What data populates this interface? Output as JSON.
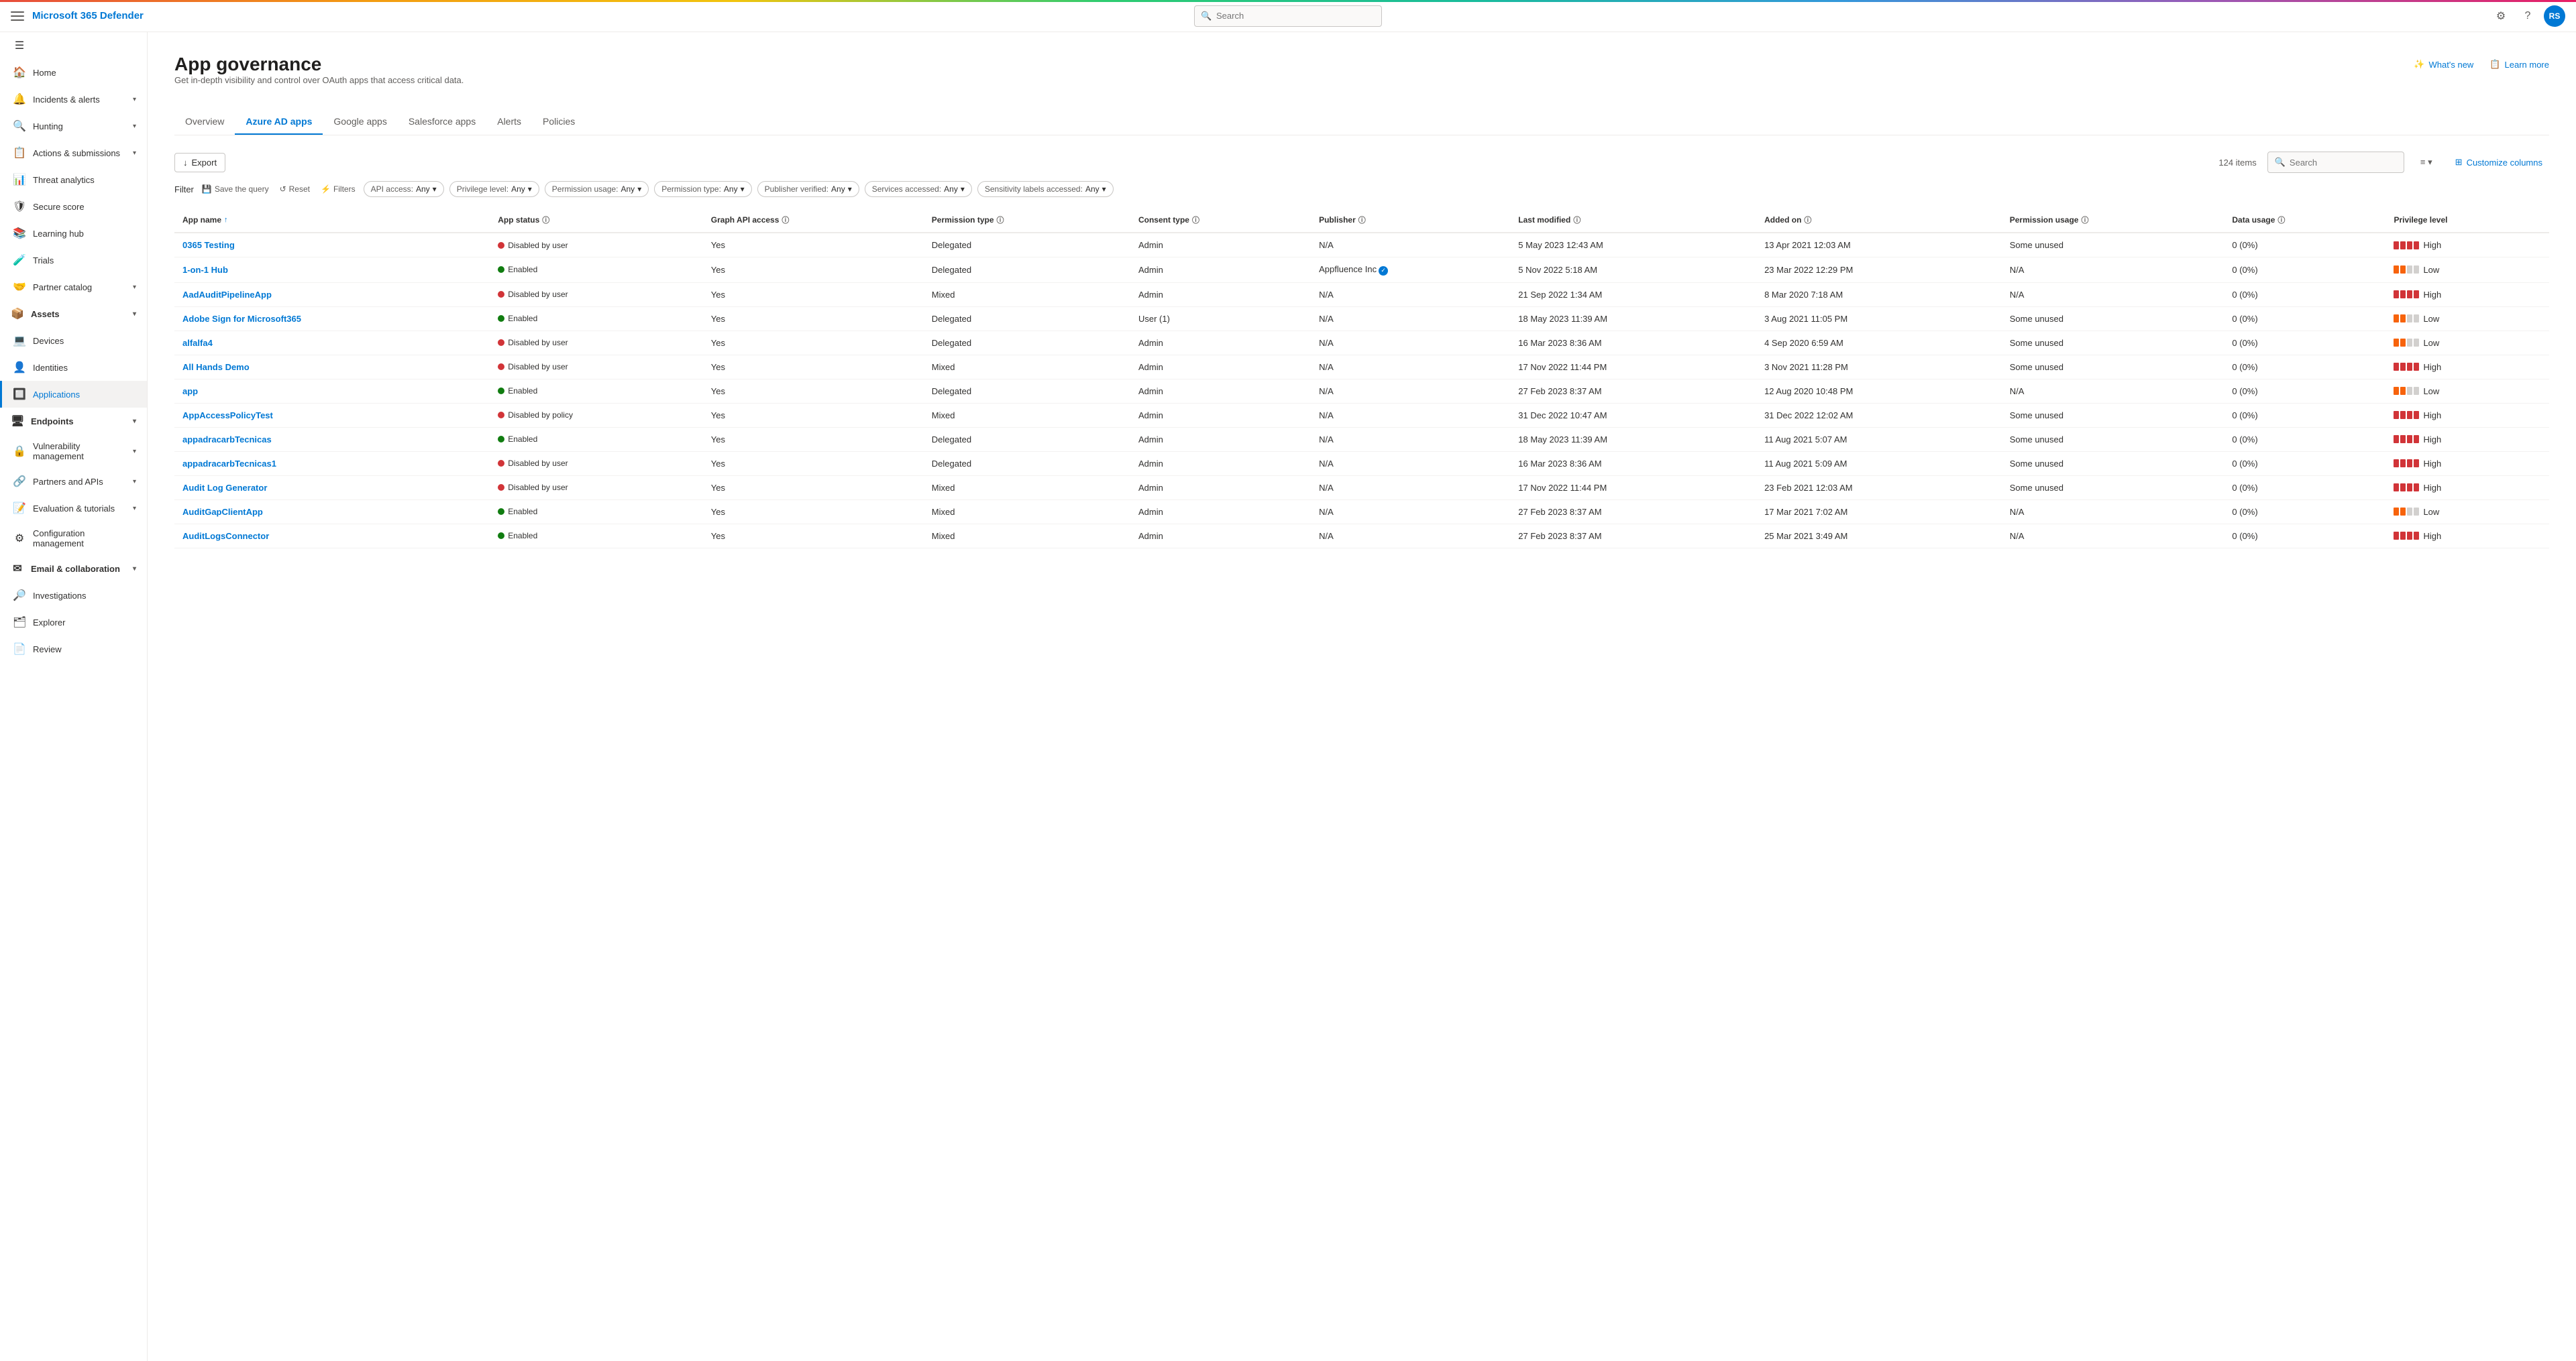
{
  "topbar": {
    "brand": "Microsoft 365 Defender",
    "search_placeholder": "Search",
    "avatar_initials": "RS"
  },
  "sidebar": {
    "collapse_label": "Collapse",
    "items": [
      {
        "id": "home",
        "icon": "🏠",
        "label": "Home",
        "chevron": false,
        "active": false
      },
      {
        "id": "incidents",
        "icon": "🔔",
        "label": "Incidents & alerts",
        "chevron": true,
        "active": false
      },
      {
        "id": "hunting",
        "icon": "🔍",
        "label": "Hunting",
        "chevron": true,
        "active": false
      },
      {
        "id": "actions",
        "icon": "📋",
        "label": "Actions & submissions",
        "chevron": true,
        "active": false
      },
      {
        "id": "threat",
        "icon": "📊",
        "label": "Threat analytics",
        "chevron": false,
        "active": false
      },
      {
        "id": "secure",
        "icon": "🛡",
        "label": "Secure score",
        "chevron": false,
        "active": false
      },
      {
        "id": "learning",
        "icon": "📚",
        "label": "Learning hub",
        "chevron": false,
        "active": false
      },
      {
        "id": "trials",
        "icon": "🧪",
        "label": "Trials",
        "chevron": false,
        "active": false
      },
      {
        "id": "partner",
        "icon": "🤝",
        "label": "Partner catalog",
        "chevron": true,
        "active": false
      },
      {
        "id": "assets-header",
        "icon": "📦",
        "label": "Assets",
        "section": true,
        "chevron": true
      },
      {
        "id": "devices",
        "icon": "💻",
        "label": "Devices",
        "chevron": false,
        "active": false
      },
      {
        "id": "identities",
        "icon": "👤",
        "label": "Identities",
        "chevron": false,
        "active": false
      },
      {
        "id": "applications",
        "icon": "🔲",
        "label": "Applications",
        "chevron": false,
        "active": true
      },
      {
        "id": "endpoints-header",
        "icon": "🖥",
        "label": "Endpoints",
        "section": true,
        "chevron": true
      },
      {
        "id": "vulnerability",
        "icon": "🔒",
        "label": "Vulnerability management",
        "chevron": true,
        "active": false
      },
      {
        "id": "partners-apis",
        "icon": "🔗",
        "label": "Partners and APIs",
        "chevron": true,
        "active": false
      },
      {
        "id": "evaluation",
        "icon": "📝",
        "label": "Evaluation & tutorials",
        "chevron": true,
        "active": false
      },
      {
        "id": "config-mgmt",
        "icon": "⚙",
        "label": "Configuration management",
        "chevron": false,
        "active": false
      },
      {
        "id": "email-collab",
        "icon": "✉",
        "label": "Email & collaboration",
        "section": true,
        "chevron": true
      },
      {
        "id": "investigations",
        "icon": "🔎",
        "label": "Investigations",
        "chevron": false,
        "active": false
      },
      {
        "id": "explorer",
        "icon": "🗂",
        "label": "Explorer",
        "chevron": false,
        "active": false
      },
      {
        "id": "review",
        "icon": "📄",
        "label": "Review",
        "chevron": false,
        "active": false
      }
    ]
  },
  "page": {
    "title": "App governance",
    "subtitle": "Get in-depth visibility and control over OAuth apps that access critical data.",
    "whats_new_label": "What's new",
    "learn_more_label": "Learn more"
  },
  "tabs": [
    {
      "id": "overview",
      "label": "Overview"
    },
    {
      "id": "azure-ad-apps",
      "label": "Azure AD apps",
      "active": true
    },
    {
      "id": "google-apps",
      "label": "Google apps"
    },
    {
      "id": "salesforce-apps",
      "label": "Salesforce apps"
    },
    {
      "id": "alerts",
      "label": "Alerts"
    },
    {
      "id": "policies",
      "label": "Policies"
    }
  ],
  "toolbar": {
    "export_label": "Export",
    "item_count": "124 items",
    "search_placeholder": "Search",
    "customize_columns_label": "Customize columns"
  },
  "filter_bar": {
    "label": "Filter",
    "save_query_label": "Save the query",
    "reset_label": "Reset",
    "filters_label": "Filters",
    "dropdowns": [
      {
        "key": "API access:",
        "value": "Any"
      },
      {
        "key": "Privilege level:",
        "value": "Any"
      },
      {
        "key": "Permission usage:",
        "value": "Any"
      },
      {
        "key": "Permission type:",
        "value": "Any"
      },
      {
        "key": "Publisher verified:",
        "value": "Any"
      },
      {
        "key": "Services accessed:",
        "value": "Any"
      },
      {
        "key": "Sensitivity labels accessed:",
        "value": "Any"
      }
    ]
  },
  "table": {
    "columns": [
      {
        "id": "app-name",
        "label": "App name",
        "sortable": true,
        "info": false
      },
      {
        "id": "app-status",
        "label": "App status",
        "sortable": false,
        "info": true
      },
      {
        "id": "graph-api-access",
        "label": "Graph API access",
        "sortable": false,
        "info": true
      },
      {
        "id": "permission-type",
        "label": "Permission type",
        "sortable": false,
        "info": true
      },
      {
        "id": "consent-type",
        "label": "Consent type",
        "sortable": false,
        "info": true
      },
      {
        "id": "publisher",
        "label": "Publisher",
        "sortable": false,
        "info": true
      },
      {
        "id": "last-modified",
        "label": "Last modified",
        "sortable": false,
        "info": true
      },
      {
        "id": "added-on",
        "label": "Added on",
        "sortable": false,
        "info": true
      },
      {
        "id": "permission-usage",
        "label": "Permission usage",
        "sortable": false,
        "info": true
      },
      {
        "id": "data-usage",
        "label": "Data usage",
        "sortable": false,
        "info": true
      },
      {
        "id": "privilege-level",
        "label": "Privilege level",
        "sortable": false,
        "info": false
      }
    ],
    "rows": [
      {
        "name": "0365 Testing",
        "status": "Disabled by user",
        "status_type": "disabled",
        "graph_api": "Yes",
        "perm_type": "Delegated",
        "consent": "Admin",
        "publisher": "N/A",
        "publisher_verified": false,
        "last_modified": "5 May 2023 12:43 AM",
        "added_on": "13 Apr 2021 12:03 AM",
        "perm_usage": "Some unused",
        "data_usage": "0 (0%)",
        "privilege": "High",
        "privilege_level": "high"
      },
      {
        "name": "1-on-1 Hub",
        "status": "Enabled",
        "status_type": "enabled",
        "graph_api": "Yes",
        "perm_type": "Delegated",
        "consent": "Admin",
        "publisher": "Appfluence Inc",
        "publisher_verified": true,
        "last_modified": "5 Nov 2022 5:18 AM",
        "added_on": "23 Mar 2022 12:29 PM",
        "perm_usage": "N/A",
        "data_usage": "0 (0%)",
        "privilege": "Low",
        "privilege_level": "low"
      },
      {
        "name": "AadAuditPipelineApp",
        "status": "Disabled by user",
        "status_type": "disabled",
        "graph_api": "Yes",
        "perm_type": "Mixed",
        "consent": "Admin",
        "publisher": "N/A",
        "publisher_verified": false,
        "last_modified": "21 Sep 2022 1:34 AM",
        "added_on": "8 Mar 2020 7:18 AM",
        "perm_usage": "N/A",
        "data_usage": "0 (0%)",
        "privilege": "High",
        "privilege_level": "high"
      },
      {
        "name": "Adobe Sign for Microsoft365",
        "status": "Enabled",
        "status_type": "enabled",
        "graph_api": "Yes",
        "perm_type": "Delegated",
        "consent": "User (1)",
        "publisher": "N/A",
        "publisher_verified": false,
        "last_modified": "18 May 2023 11:39 AM",
        "added_on": "3 Aug 2021 11:05 PM",
        "perm_usage": "Some unused",
        "data_usage": "0 (0%)",
        "privilege": "Low",
        "privilege_level": "low"
      },
      {
        "name": "alfalfa4",
        "status": "Disabled by user",
        "status_type": "disabled",
        "graph_api": "Yes",
        "perm_type": "Delegated",
        "consent": "Admin",
        "publisher": "N/A",
        "publisher_verified": false,
        "last_modified": "16 Mar 2023 8:36 AM",
        "added_on": "4 Sep 2020 6:59 AM",
        "perm_usage": "Some unused",
        "data_usage": "0 (0%)",
        "privilege": "Low",
        "privilege_level": "low"
      },
      {
        "name": "All Hands Demo",
        "status": "Disabled by user",
        "status_type": "disabled",
        "graph_api": "Yes",
        "perm_type": "Mixed",
        "consent": "Admin",
        "publisher": "N/A",
        "publisher_verified": false,
        "last_modified": "17 Nov 2022 11:44 PM",
        "added_on": "3 Nov 2021 11:28 PM",
        "perm_usage": "Some unused",
        "data_usage": "0 (0%)",
        "privilege": "High",
        "privilege_level": "high"
      },
      {
        "name": "app",
        "status": "Enabled",
        "status_type": "enabled",
        "graph_api": "Yes",
        "perm_type": "Delegated",
        "consent": "Admin",
        "publisher": "N/A",
        "publisher_verified": false,
        "last_modified": "27 Feb 2023 8:37 AM",
        "added_on": "12 Aug 2020 10:48 PM",
        "perm_usage": "N/A",
        "data_usage": "0 (0%)",
        "privilege": "Low",
        "privilege_level": "low"
      },
      {
        "name": "AppAccessPolicyTest",
        "status": "Disabled by policy",
        "status_type": "disabled",
        "graph_api": "Yes",
        "perm_type": "Mixed",
        "consent": "Admin",
        "publisher": "N/A",
        "publisher_verified": false,
        "last_modified": "31 Dec 2022 10:47 AM",
        "added_on": "31 Dec 2022 12:02 AM",
        "perm_usage": "Some unused",
        "data_usage": "0 (0%)",
        "privilege": "High",
        "privilege_level": "high"
      },
      {
        "name": "appadracarbTecnicas",
        "status": "Enabled",
        "status_type": "enabled",
        "graph_api": "Yes",
        "perm_type": "Delegated",
        "consent": "Admin",
        "publisher": "N/A",
        "publisher_verified": false,
        "last_modified": "18 May 2023 11:39 AM",
        "added_on": "11 Aug 2021 5:07 AM",
        "perm_usage": "Some unused",
        "data_usage": "0 (0%)",
        "privilege": "High",
        "privilege_level": "high"
      },
      {
        "name": "appadracarbTecnicas1",
        "status": "Disabled by user",
        "status_type": "disabled",
        "graph_api": "Yes",
        "perm_type": "Delegated",
        "consent": "Admin",
        "publisher": "N/A",
        "publisher_verified": false,
        "last_modified": "16 Mar 2023 8:36 AM",
        "added_on": "11 Aug 2021 5:09 AM",
        "perm_usage": "Some unused",
        "data_usage": "0 (0%)",
        "privilege": "High",
        "privilege_level": "high"
      },
      {
        "name": "Audit Log Generator",
        "status": "Disabled by user",
        "status_type": "disabled",
        "graph_api": "Yes",
        "perm_type": "Mixed",
        "consent": "Admin",
        "publisher": "N/A",
        "publisher_verified": false,
        "last_modified": "17 Nov 2022 11:44 PM",
        "added_on": "23 Feb 2021 12:03 AM",
        "perm_usage": "Some unused",
        "data_usage": "0 (0%)",
        "privilege": "High",
        "privilege_level": "high"
      },
      {
        "name": "AuditGapClientApp",
        "status": "Enabled",
        "status_type": "enabled",
        "graph_api": "Yes",
        "perm_type": "Mixed",
        "consent": "Admin",
        "publisher": "N/A",
        "publisher_verified": false,
        "last_modified": "27 Feb 2023 8:37 AM",
        "added_on": "17 Mar 2021 7:02 AM",
        "perm_usage": "N/A",
        "data_usage": "0 (0%)",
        "privilege": "Low",
        "privilege_level": "low"
      },
      {
        "name": "AuditLogsConnector",
        "status": "Enabled",
        "status_type": "enabled",
        "graph_api": "Yes",
        "perm_type": "Mixed",
        "consent": "Admin",
        "publisher": "N/A",
        "publisher_verified": false,
        "last_modified": "27 Feb 2023 8:37 AM",
        "added_on": "25 Mar 2021 3:49 AM",
        "perm_usage": "N/A",
        "data_usage": "0 (0%)",
        "privilege": "High",
        "privilege_level": "high"
      }
    ]
  },
  "icons": {
    "export": "↓",
    "save_query": "💾",
    "reset": "↺",
    "filters": "⚡",
    "search": "🔍",
    "customize": "⊞",
    "sort": "↑",
    "chevron_down": "▾",
    "whats_new": "✨",
    "learn_more": "📋",
    "settings": "⚙",
    "help": "?",
    "filter_icon": "≡"
  }
}
